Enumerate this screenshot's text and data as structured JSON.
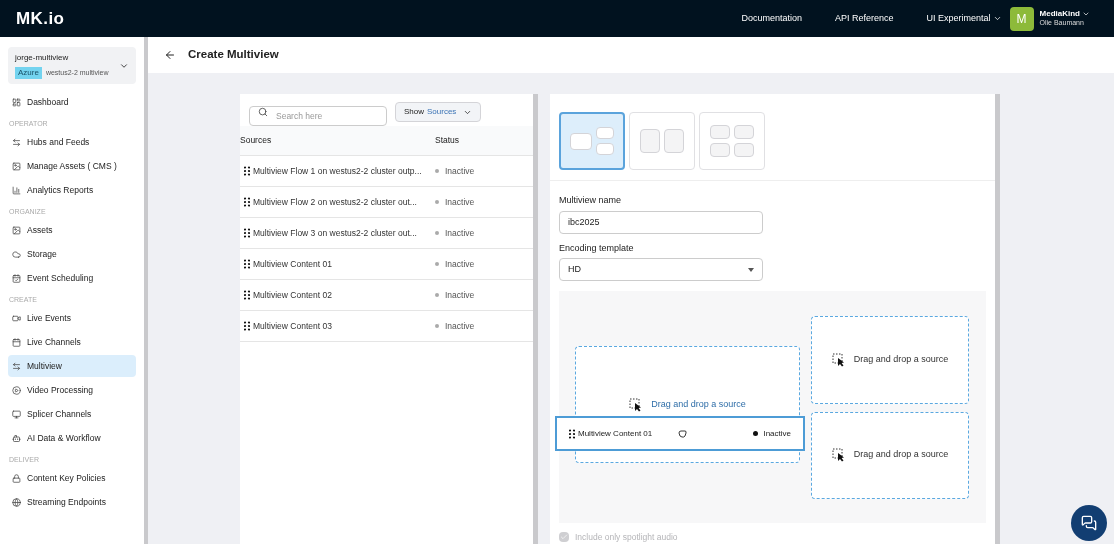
{
  "header": {
    "logo": "MK.io",
    "links": [
      "Documentation",
      "API Reference"
    ],
    "menu": "UI Experimental",
    "avatar": "M",
    "org": "MediaKind",
    "user": "Olie Baumann"
  },
  "workspace": {
    "name": "jorge-multiview",
    "cloud": "Azure",
    "region": "westus2-2 multiview"
  },
  "sidebar": [
    {
      "kind": "item",
      "label": "Dashboard",
      "selected": false
    },
    {
      "kind": "section",
      "label": "OPERATOR"
    },
    {
      "kind": "item",
      "label": "Hubs and Feeds",
      "selected": false
    },
    {
      "kind": "item",
      "label": "Manage Assets ( CMS )",
      "selected": false
    },
    {
      "kind": "item",
      "label": "Analytics Reports",
      "selected": false
    },
    {
      "kind": "section",
      "label": "ORGANIZE"
    },
    {
      "kind": "item",
      "label": "Assets",
      "selected": false
    },
    {
      "kind": "item",
      "label": "Storage",
      "selected": false
    },
    {
      "kind": "item",
      "label": "Event Scheduling",
      "selected": false
    },
    {
      "kind": "section",
      "label": "CREATE"
    },
    {
      "kind": "item",
      "label": "Live Events",
      "selected": false
    },
    {
      "kind": "item",
      "label": "Live Channels",
      "selected": false
    },
    {
      "kind": "item",
      "label": "Multiview",
      "selected": true
    },
    {
      "kind": "item",
      "label": "Video Processing",
      "selected": false
    },
    {
      "kind": "item",
      "label": "Splicer Channels",
      "selected": false
    },
    {
      "kind": "item",
      "label": "AI Data & Workflow",
      "selected": false
    },
    {
      "kind": "section",
      "label": "DELIVER"
    },
    {
      "kind": "item",
      "label": "Content Key Policies",
      "selected": false
    },
    {
      "kind": "item",
      "label": "Streaming Endpoints",
      "selected": false
    }
  ],
  "page_title": "Create Multiview",
  "sources": {
    "search_placeholder": "Search here",
    "show_label": "Show",
    "show_value": "Sources",
    "columns": [
      "Sources",
      "Status"
    ],
    "rows": [
      {
        "name": "Multiview Flow 1 on westus2-2 cluster outp...",
        "status": "Inactive"
      },
      {
        "name": "Multiview Flow 2 on westus2-2 cluster out...",
        "status": "Inactive"
      },
      {
        "name": "Multiview Flow 3 on westus2-2 cluster out...",
        "status": "Inactive"
      },
      {
        "name": "Multiview Content 01",
        "status": "Inactive"
      },
      {
        "name": "Multiview Content 02",
        "status": "Inactive"
      },
      {
        "name": "Multiview Content 03",
        "status": "Inactive"
      }
    ]
  },
  "layouts": [
    {
      "kind": "one-plus-two",
      "selected": true
    },
    {
      "kind": "two",
      "selected": false
    },
    {
      "kind": "four",
      "selected": false
    }
  ],
  "form": {
    "name_label": "Multiview name",
    "name_value": "ibc2025",
    "template_label": "Encoding template",
    "template_value": "HD"
  },
  "drop_zones": [
    {
      "text": "Drag and drop a source",
      "highlighted": true
    },
    {
      "text": "Drag and drop a source",
      "highlighted": false
    },
    {
      "text": "Drag and drop a source",
      "highlighted": false
    }
  ],
  "dragged_item": {
    "name": "Multiview Content 01",
    "status": "Inactive"
  },
  "spotlight_audio": {
    "label": "Include only spotlight audio",
    "checked": true,
    "disabled": true
  }
}
